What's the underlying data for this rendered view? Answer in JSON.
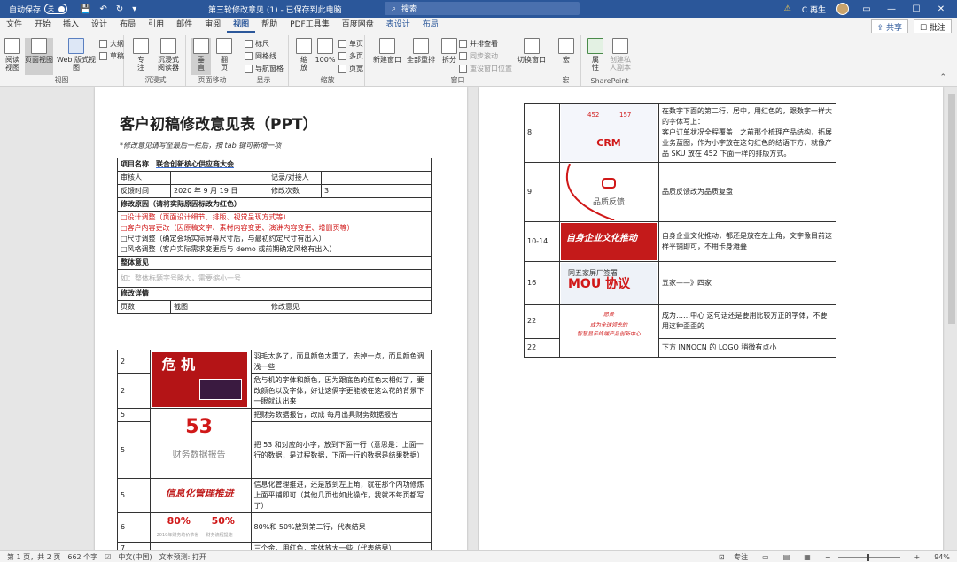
{
  "titlebar": {
    "autosave_label": "自动保存",
    "autosave_state": "关",
    "title": "第三轮修改意见 (1)  -  已保存到此电脑",
    "search_placeholder": "搜索",
    "warning": "⚠",
    "user": "C 再生"
  },
  "tabs": [
    {
      "label": "文件"
    },
    {
      "label": "开始"
    },
    {
      "label": "插入"
    },
    {
      "label": "设计"
    },
    {
      "label": "布局"
    },
    {
      "label": "引用"
    },
    {
      "label": "邮件"
    },
    {
      "label": "审阅"
    },
    {
      "label": "视图"
    },
    {
      "label": "帮助"
    },
    {
      "label": "PDF工具集"
    },
    {
      "label": "百度网盘"
    },
    {
      "label": "表设计"
    },
    {
      "label": "布局"
    }
  ],
  "share_label": "共享",
  "comment_label": "批注",
  "ribbon": {
    "read_mode": "阅读\n视图",
    "print_layout": "页面视图",
    "web_layout": "Web 版式视图",
    "outline": "大纲",
    "draft": "草稿",
    "views_group": "视图",
    "focus": "专\n注",
    "immersive_reader": "沉浸式\n阅读器",
    "immersive_group": "沉浸式",
    "vertical": "垂\n直",
    "side_to_side": "翻\n页",
    "page_move_group": "页面移动",
    "ruler": "标尺",
    "gridlines": "网格线",
    "nav_pane": "导航窗格",
    "show_group": "显示",
    "zoom": "缩\n放",
    "zoom_100": "100%",
    "one_page": "单页",
    "multi_page": "多页",
    "page_width": "页宽",
    "zoom_group": "缩放",
    "new_window": "新建窗口",
    "arrange_all": "全部重排",
    "split": "拆分",
    "side_by_side": "并排查看",
    "sync_scroll": "同步滚动",
    "reset_window": "重设窗口位置",
    "switch_windows": "切换窗口",
    "window_group": "窗口",
    "macros": "宏",
    "macros_group": "宏",
    "properties": "属\n性",
    "create_private": "创建私\n人副本",
    "sharepoint_group": "SharePoint"
  },
  "doc": {
    "title": "客户初稿修改意见表（PPT）",
    "note": "*修改意见请写至最后一栏后，按 tab 键可新增一项",
    "project_label": "项目名称",
    "project_name": "联合创新核心供应商大会",
    "reviewer_label": "审核人",
    "recorder_label": "记录/对接人",
    "feedback_time_label": "反馈时间",
    "feedback_time": "2020 年 9 月 19 日",
    "revision_count_label": "修改次数",
    "revision_count": "3",
    "reason_label": "修改原因（请将实际原因标改为红色）",
    "reasons": [
      "□设计调整（页面设计细节、排版、视觉呈现方式等）",
      "□客户内容更改（因原稿文字、素材内容变更、演讲内容变更、增删页等）",
      "□尺寸调整（确定会场实际屏幕尺寸后，与最初约定尺寸有出入）",
      "□风格调整（客户实际需求变更后与 demo 或前期确定风格有出入）"
    ],
    "overall_label": "整体意见",
    "overall_text": "如：整体标题字号略大，需要缩小一号",
    "details_label": "修改详情",
    "col_page": "页数",
    "col_shot": "截图",
    "col_opinion": "修改意见"
  },
  "left_rows": [
    {
      "page": "2",
      "opinion": "羽毛太多了，而且颜色太重了，去掉一点，而且颜色调浅一些"
    },
    {
      "page": "2",
      "opinion": "危与机的字体和颜色，因为跟底色的红色太相似了，要改颜色以及字体，好让这俩字更能被在这么花的背景下一眼就认出来"
    },
    {
      "page": "5",
      "opinion": "把财务数据报告，改成 每月出具财务数据报告"
    },
    {
      "page": "5",
      "opinion": "把 53 和对应的小字，放到下面一行（意思是：上面一行的数据，是过程数据，下面一行的数据是结果数据）"
    },
    {
      "page": "5",
      "opinion": "信息化管理推进，还是放到左上角，就在那个内功修炼上面平铺即可（其他几页也如此操作，我就不每页都写了）"
    },
    {
      "page": "6",
      "opinion": "80%和 50%放到第二行，代表结果"
    },
    {
      "page": "7",
      "opinion": "三个金，用红色，字体放大一些（代表结果）"
    }
  ],
  "left_thumbs": {
    "danger_title": "危 机",
    "finance_num": "53",
    "finance_label": "财务数据报告",
    "info_mgmt": "信息化管理推进",
    "pct_a": "80%",
    "pct_b": "50%",
    "pct_a_sub": "2019年财务均价节省",
    "pct_b_sub": "财务流程提速"
  },
  "right_rows": [
    {
      "page": "8",
      "opinion": "在数字下面的第二行，居中，用红色的，跟数字一样大的字体写上：\n客户订单状况全程覆盖　之前那个梳理产品结构，拓展业务蓝图，作为小字放在这句红色的结语下方，就像产品 SKU 放在 452 下面一样的排版方式。"
    },
    {
      "page": "9",
      "opinion": "品质反馈改为品质复盘"
    },
    {
      "page": "10-14",
      "opinion": "自身企业文化推动，都还是放在左上角，文字像目前这样平铺即可，不用卡身滩叠"
    },
    {
      "page": "16",
      "opinion": "五家——》四家"
    },
    {
      "page": "22",
      "opinion": "成为……中心 这句话还是要用比较方正的字体，不要用这种歪歪的"
    },
    {
      "page": "22",
      "opinion": "下方 INNOCN 的 LOGO 稍微有点小"
    }
  ],
  "right_thumbs": {
    "crm_num_a": "452",
    "crm_num_b": "157",
    "crm_label": "CRM",
    "quality": "品质反馈",
    "culture": "自身企业文化推动",
    "mou_sub": "同五家屏厂签署",
    "mou": "MOU 协议",
    "center_a": "愿景",
    "center_b": "成为全球领先的",
    "center_c": "智慧显示终端产品创新中心"
  },
  "status": {
    "pages": "第 1 页，共 2 页",
    "words": "662 个字",
    "lang": "中文(中国)",
    "predict": "文本预测: 打开",
    "focus": "专注",
    "zoom": "94%"
  },
  "colors": {
    "brand": "#2b579a",
    "accent_red": "#d01818"
  }
}
